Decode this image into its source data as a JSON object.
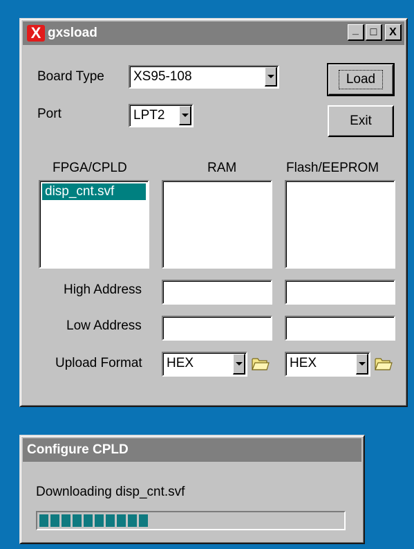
{
  "main_window": {
    "title": "gxsload",
    "app_icon": "X",
    "title_buttons": {
      "minimize": "_",
      "maximize": "□",
      "close": "X"
    },
    "board_type_label": "Board Type",
    "board_type_value": "XS95-108",
    "port_label": "Port",
    "port_value": "LPT2",
    "load_button": "Load",
    "exit_button": "Exit",
    "fpga_label": "FPGA/CPLD",
    "ram_label": "RAM",
    "flash_label": "Flash/EEPROM",
    "fpga_files": [
      "disp_cnt.svf"
    ],
    "high_address_label": "High Address",
    "low_address_label": "Low Address",
    "upload_format_label": "Upload Format",
    "ram_upload_format": "HEX",
    "flash_upload_format": "HEX",
    "icons": {
      "ram_folder": "folder-icon",
      "flash_folder": "folder-icon"
    }
  },
  "progress_window": {
    "title": "Configure CPLD",
    "status": "Downloading disp_cnt.svf",
    "progress_fraction": 0.36,
    "accent_color": "#0f7a80"
  },
  "colors": {
    "desktop": "#0a73b5",
    "window_face": "#c3c3c3",
    "selection": "#008080",
    "app_icon_red": "#e21b1b"
  }
}
